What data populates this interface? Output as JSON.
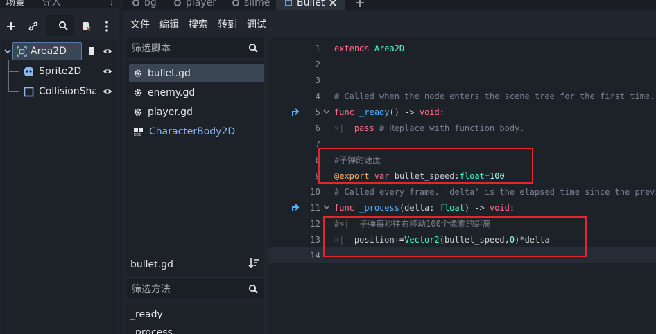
{
  "scene_panel": {
    "tabs": [
      {
        "label": "场景",
        "active": true
      },
      {
        "label": "导入",
        "active": false
      }
    ],
    "nodes": [
      {
        "label": "Area2D",
        "icon": "area2d-icon",
        "selected": true
      },
      {
        "label": "Sprite2D",
        "icon": "sprite2d-icon"
      },
      {
        "label": "CollisionSha",
        "icon": "collision-shape-icon"
      }
    ]
  },
  "editor": {
    "tabs": [
      {
        "label": "bg",
        "icon": "gear-icon"
      },
      {
        "label": "player",
        "icon": "gear-icon"
      },
      {
        "label": "slime",
        "icon": "gear-icon"
      },
      {
        "label": "Bullet",
        "icon": "area2d-icon",
        "active": true
      }
    ],
    "menu": [
      "文件",
      "编辑",
      "搜索",
      "转到",
      "调试"
    ]
  },
  "script_panel": {
    "filter_placeholder": "筛选脚本",
    "scripts": [
      {
        "label": "bullet.gd",
        "selected": true
      },
      {
        "label": "enemy.gd"
      },
      {
        "label": "player.gd"
      },
      {
        "label": "CharacterBody2D",
        "doc": true
      }
    ],
    "current_script": "bullet.gd",
    "method_filter_placeholder": "筛选方法",
    "methods": [
      "_ready",
      "_process"
    ]
  },
  "code": {
    "lines": [
      {
        "n": "1",
        "tokens": [
          [
            "kw",
            "extends"
          ],
          [
            "",
            " "
          ],
          [
            "ty",
            "Area2D"
          ]
        ]
      },
      {
        "n": "2",
        "tokens": []
      },
      {
        "n": "3",
        "tokens": []
      },
      {
        "n": "4",
        "tokens": [
          [
            "cm",
            "# Called when the node enters the scene tree for the first time."
          ]
        ]
      },
      {
        "n": "5",
        "tokens": [
          [
            "kw",
            "func"
          ],
          [
            "",
            " "
          ],
          [
            "fn",
            "_ready"
          ],
          [
            "",
            "() -> "
          ],
          [
            "kw",
            "void"
          ],
          [
            "",
            ":"
          ]
        ]
      },
      {
        "n": "6",
        "tokens": [
          [
            "tabmark",
            "»|  "
          ],
          [
            "kw",
            "pass"
          ],
          [
            "cm",
            " # Replace with function body."
          ]
        ]
      },
      {
        "n": "7",
        "tokens": []
      },
      {
        "n": "8",
        "tokens": [
          [
            "cm",
            "#子弹的速度"
          ]
        ]
      },
      {
        "n": "9",
        "tokens": [
          [
            "annot",
            "@export"
          ],
          [
            "",
            " "
          ],
          [
            "kw",
            "var"
          ],
          [
            "",
            " bullet_speed:"
          ],
          [
            "ty",
            "float"
          ],
          [
            "",
            "="
          ],
          [
            "num",
            "100"
          ]
        ]
      },
      {
        "n": "10",
        "tokens": [
          [
            "cm",
            "# Called every frame. 'delta' is the elapsed time since the previous frame."
          ]
        ]
      },
      {
        "n": "11",
        "tokens": [
          [
            "kw",
            "func"
          ],
          [
            "",
            " "
          ],
          [
            "fn",
            "_process"
          ],
          [
            "",
            "(delta: "
          ],
          [
            "ty",
            "float"
          ],
          [
            "",
            ") -> "
          ],
          [
            "kw",
            "void"
          ],
          [
            "",
            ":"
          ]
        ]
      },
      {
        "n": "12",
        "tokens": [
          [
            "cm",
            "#»|  子弹每秒往右移动100个像素的距离"
          ]
        ]
      },
      {
        "n": "13",
        "tokens": [
          [
            "tabmark",
            "»|  "
          ],
          [
            "",
            "position+="
          ],
          [
            "ty",
            "Vector2"
          ],
          [
            "",
            "(bullet_speed,"
          ],
          [
            "num",
            "0"
          ],
          [
            "",
            ")*delta"
          ]
        ]
      },
      {
        "n": "14",
        "tokens": []
      }
    ]
  },
  "colors": {
    "accent": "#4a9aff",
    "annotation_box": "#e3262c"
  }
}
